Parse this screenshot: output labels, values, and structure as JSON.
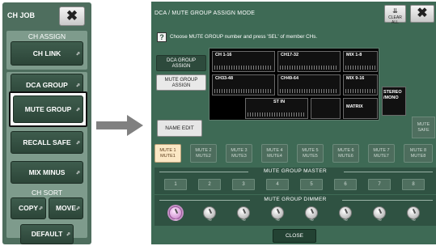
{
  "ch_job": {
    "title": "CH JOB",
    "close_label": "✖",
    "ch_assign_label": "CH ASSIGN",
    "ch_link_label": "CH LINK",
    "dca_group_label": "DCA GROUP",
    "mute_group_label": "MUTE GROUP",
    "recall_safe_label": "RECALL SAFE",
    "mix_minus_label": "MIX MINUS",
    "ch_sort_label": "CH SORT",
    "copy_label": "COPY",
    "move_label": "MOVE",
    "default_label": "DEFAULT",
    "corner_mark": "⬀"
  },
  "dca_mute": {
    "title": "DCA / MUTE GROUP ASSIGN MODE",
    "clear_all_label": "CLEAR ALL",
    "close_x_label": "✖",
    "help_label": "?",
    "instruction": "Choose MUTE GROUP number and press 'SEL' of member CHs.",
    "dca_group_assign_label": "DCA GROUP\nASSIGN",
    "mute_group_assign_label": "MUTE GROUP\nASSIGN",
    "blocks": [
      {
        "label": "CH 1-16"
      },
      {
        "label": "CH17-32"
      },
      {
        "label": "MIX 1-8"
      },
      {
        "label": "CH33-48"
      },
      {
        "label": "CH49-64"
      },
      {
        "label": "MIX 9-16"
      },
      {
        "label": "ST IN"
      },
      {
        "label": "MATRIX"
      },
      {
        "label": "STEREO\n/MONO"
      }
    ],
    "name_edit_label": "NAME EDIT",
    "mute_safe_label": "MUTE\nSAFE",
    "mute_buttons": [
      {
        "label": "MUTE 1\nMUTE1",
        "active": true
      },
      {
        "label": "MUTE 2\nMUTE2",
        "active": false
      },
      {
        "label": "MUTE 3\nMUTE3",
        "active": false
      },
      {
        "label": "MUTE 4\nMUTE4",
        "active": false
      },
      {
        "label": "MUTE 5\nMUTE5",
        "active": false
      },
      {
        "label": "MUTE 6\nMUTE6",
        "active": false
      },
      {
        "label": "MUTE 7\nMUTE7",
        "active": false
      },
      {
        "label": "MUTE 8\nMUTE8",
        "active": false
      }
    ],
    "master_title": "MUTE GROUP MASTER",
    "master_buttons": [
      "1",
      "2",
      "3",
      "4",
      "5",
      "6",
      "7",
      "8"
    ],
    "dimmer_title": "MUTE GROUP DIMMER",
    "dimmer_values": [
      "-∞",
      "-∞",
      "-∞",
      "-∞",
      "-∞",
      "-∞",
      "-∞",
      "-∞"
    ],
    "close_label": "CLOSE"
  },
  "colors": {
    "panel_green": "#4e6e5e",
    "window_green": "#3e6a55",
    "active_mute": "#fbe7c4",
    "arrow_gray": "#808080"
  }
}
